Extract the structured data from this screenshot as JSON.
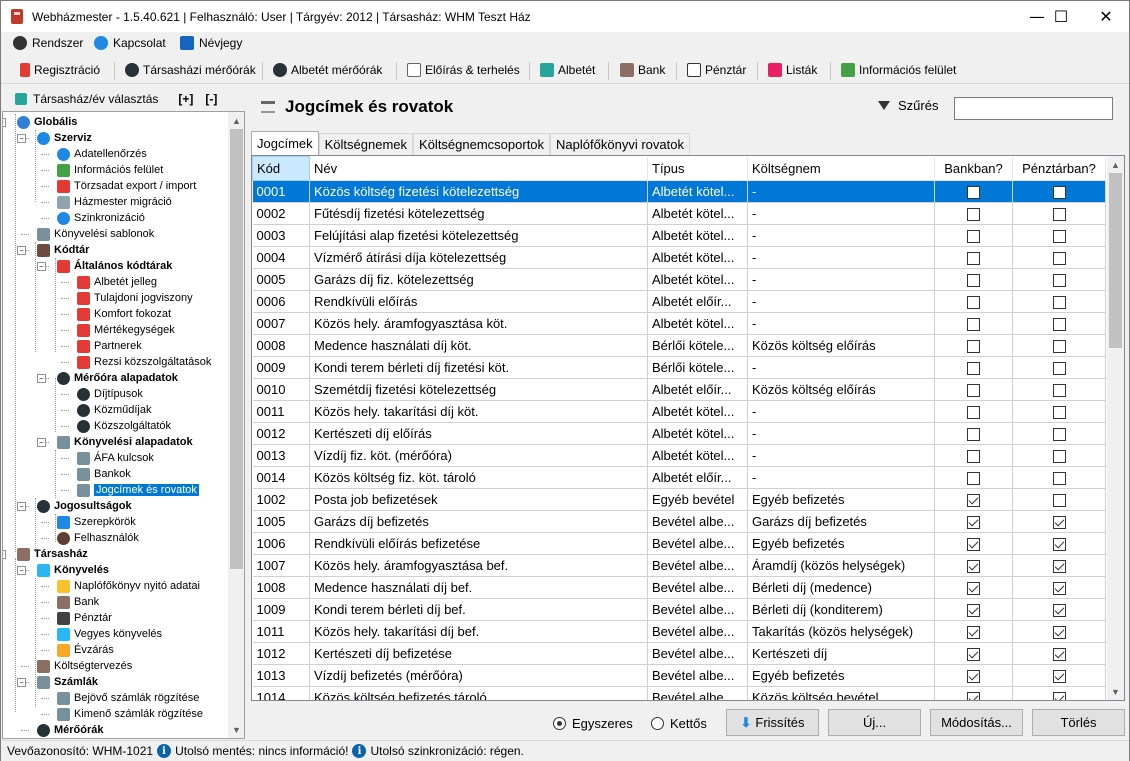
{
  "window": {
    "title": "Webházmester - 1.5.40.621 | Felhasználó: User | Tárgyév: 2012 | Társasház: WHM Teszt Ház",
    "minimize": "—",
    "maximize": "☐",
    "close": "✕"
  },
  "menu": {
    "items": [
      "Rendszer",
      "Kapcsolat",
      "Névjegy"
    ]
  },
  "toolbar": {
    "items": [
      "Regisztráció",
      "Társasházi mérőórák",
      "Albetét mérőórák",
      "Előírás & terhelés",
      "Albetét",
      "Bank",
      "Pénztár",
      "Listák",
      "Információs felület"
    ]
  },
  "sidebar": {
    "select_label": "Társasház/év választás",
    "expand": "[+]",
    "collapse": "[-]"
  },
  "tree": [
    {
      "label": "Globális",
      "level": 0,
      "bold": true,
      "icon": "globe-icon",
      "color": "#2f7fd8"
    },
    {
      "label": "Szerviz",
      "level": 1,
      "bold": true,
      "icon": "info-icon",
      "color": "#1e88e5"
    },
    {
      "label": "Adatellenőrzés",
      "level": 2,
      "icon": "info-icon",
      "color": "#1e88e5"
    },
    {
      "label": "Információs felület",
      "level": 2,
      "icon": "chart-icon",
      "color": "#43a047"
    },
    {
      "label": "Törzsadat export / import",
      "level": 2,
      "icon": "export-icon",
      "color": "#e53935"
    },
    {
      "label": "Házmester migráció",
      "level": 2,
      "icon": "migrate-icon",
      "color": "#90a4ae"
    },
    {
      "label": "Szinkronizáció",
      "level": 2,
      "icon": "sync-icon",
      "color": "#1e88e5"
    },
    {
      "label": "Könyvelési sablonok",
      "level": 1,
      "icon": "template-icon",
      "color": "#78909c"
    },
    {
      "label": "Kódtár",
      "level": 1,
      "bold": true,
      "icon": "book-icon",
      "color": "#6d4c41"
    },
    {
      "label": "Általános kódtárak",
      "level": 2,
      "bold": true,
      "icon": "list-icon",
      "color": "#e53935"
    },
    {
      "label": "Albetét jelleg",
      "level": 3,
      "icon": "list-icon",
      "color": "#e53935"
    },
    {
      "label": "Tulajdoni jogviszony",
      "level": 3,
      "icon": "list-icon",
      "color": "#e53935"
    },
    {
      "label": "Komfort fokozat",
      "level": 3,
      "icon": "list-icon",
      "color": "#e53935"
    },
    {
      "label": "Mértékegységek",
      "level": 3,
      "icon": "list-icon",
      "color": "#e53935"
    },
    {
      "label": "Partnerek",
      "level": 3,
      "icon": "list-icon",
      "color": "#e53935"
    },
    {
      "label": "Rezsi közszolgáltatások",
      "level": 3,
      "icon": "list-icon",
      "color": "#e53935"
    },
    {
      "label": "Mérőóra alapadatok",
      "level": 2,
      "bold": true,
      "icon": "meter-icon",
      "color": "#263238"
    },
    {
      "label": "Díjtípusok",
      "level": 3,
      "icon": "meter-icon",
      "color": "#263238"
    },
    {
      "label": "Közműdíjak",
      "level": 3,
      "icon": "meter-icon",
      "color": "#263238"
    },
    {
      "label": "Közszolgáltatók",
      "level": 3,
      "icon": "meter-icon",
      "color": "#263238"
    },
    {
      "label": "Könyvelési alapadatok",
      "level": 2,
      "bold": true,
      "icon": "list-icon",
      "color": "#78909c"
    },
    {
      "label": "ÁFA kulcsok",
      "level": 3,
      "icon": "list-icon",
      "color": "#78909c"
    },
    {
      "label": "Bankok",
      "level": 3,
      "icon": "list-icon",
      "color": "#78909c"
    },
    {
      "label": "Jogcímek és rovatok",
      "level": 3,
      "icon": "list-icon",
      "color": "#78909c",
      "selected": true
    },
    {
      "label": "Jogosultságok",
      "level": 1,
      "bold": true,
      "icon": "key-icon",
      "color": "#263238"
    },
    {
      "label": "Szerepkörök",
      "level": 2,
      "icon": "role-icon",
      "color": "#1e88e5"
    },
    {
      "label": "Felhasználók",
      "level": 2,
      "icon": "user-icon",
      "color": "#5d4037"
    },
    {
      "label": "Társasház",
      "level": 0,
      "bold": true,
      "icon": "building-icon",
      "color": "#8d6e63"
    },
    {
      "label": "Könyvelés",
      "level": 1,
      "bold": true,
      "icon": "folder-icon",
      "color": "#29b6f6"
    },
    {
      "label": "Naplófőkönyv nyitó adatai",
      "level": 2,
      "icon": "grid-icon",
      "color": "#fbc02d"
    },
    {
      "label": "Bank",
      "level": 2,
      "icon": "bank-icon",
      "color": "#8d6e63"
    },
    {
      "label": "Pénztár",
      "level": 2,
      "icon": "cash-icon",
      "color": "#424242"
    },
    {
      "label": "Vegyes könyvelés",
      "level": 2,
      "icon": "folder-icon",
      "color": "#29b6f6"
    },
    {
      "label": "Évzárás",
      "level": 2,
      "icon": "lock-icon",
      "color": "#f9a825"
    },
    {
      "label": "Költségtervezés",
      "level": 1,
      "icon": "budget-icon",
      "color": "#8d6e63"
    },
    {
      "label": "Számlák",
      "level": 1,
      "bold": true,
      "icon": "invoice-icon",
      "color": "#78909c"
    },
    {
      "label": "Bejövő számlák rögzítése",
      "level": 2,
      "icon": "invoice-in-icon",
      "color": "#78909c"
    },
    {
      "label": "Kimenő számlák rögzítése",
      "level": 2,
      "icon": "invoice-out-icon",
      "color": "#78909c"
    },
    {
      "label": "Mérőórák",
      "level": 1,
      "bold": true,
      "icon": "meter-icon",
      "color": "#263238"
    }
  ],
  "main": {
    "title": "Jogcímek és rovatok",
    "filter_label": "Szűrés",
    "filter_value": "",
    "tabs": [
      "Jogcímek",
      "Költségnemek",
      "Költségnemcsoportok",
      "Naplófőkönyvi rovatok"
    ],
    "columns": [
      "Kód",
      "Név",
      "Típus",
      "Költségnem",
      "Bankban?",
      "Pénztárban?"
    ],
    "rows": [
      {
        "kod": "0001",
        "nev": "Közös költség fizetési kötelezettség",
        "tipus": "Albetét kötel...",
        "koltsegnem": "-",
        "bank": false,
        "penztar": false,
        "selected": true
      },
      {
        "kod": "0002",
        "nev": "Fűtésdíj fizetési kötelezettség",
        "tipus": "Albetét kötel...",
        "koltsegnem": "-",
        "bank": false,
        "penztar": false
      },
      {
        "kod": "0003",
        "nev": "Felújítási alap fizetési kötelezettség",
        "tipus": "Albetét kötel...",
        "koltsegnem": "-",
        "bank": false,
        "penztar": false
      },
      {
        "kod": "0004",
        "nev": "Vízmérő átírási díja kötelezettség",
        "tipus": "Albetét kötel...",
        "koltsegnem": "-",
        "bank": false,
        "penztar": false
      },
      {
        "kod": "0005",
        "nev": "Garázs díj fiz. kötelezettség",
        "tipus": "Albetét kötel...",
        "koltsegnem": "-",
        "bank": false,
        "penztar": false
      },
      {
        "kod": "0006",
        "nev": "Rendkívüli előírás",
        "tipus": "Albetét előír...",
        "koltsegnem": "-",
        "bank": false,
        "penztar": false
      },
      {
        "kod": "0007",
        "nev": "Közös hely. áramfogyasztása köt.",
        "tipus": "Albetét kötel...",
        "koltsegnem": "-",
        "bank": false,
        "penztar": false
      },
      {
        "kod": "0008",
        "nev": "Medence használati díj köt.",
        "tipus": "Bérlői kötele...",
        "koltsegnem": "Közös költség előírás",
        "bank": false,
        "penztar": false
      },
      {
        "kod": "0009",
        "nev": "Kondi terem bérleti díj fizetési köt.",
        "tipus": "Bérlői kötele...",
        "koltsegnem": "-",
        "bank": false,
        "penztar": false
      },
      {
        "kod": "0010",
        "nev": "Szemétdíj fizetési kötelezettség",
        "tipus": "Albetét előír...",
        "koltsegnem": "Közös költség előírás",
        "bank": false,
        "penztar": false
      },
      {
        "kod": "0011",
        "nev": "Közös hely. takarítási díj köt.",
        "tipus": "Albetét kötel...",
        "koltsegnem": "-",
        "bank": false,
        "penztar": false
      },
      {
        "kod": "0012",
        "nev": "Kertészeti díj előírás",
        "tipus": "Albetét kötel...",
        "koltsegnem": "-",
        "bank": false,
        "penztar": false
      },
      {
        "kod": "0013",
        "nev": "Vízdíj fiz. köt. (mérőóra)",
        "tipus": "Albetét kötel...",
        "koltsegnem": "-",
        "bank": false,
        "penztar": false
      },
      {
        "kod": "0014",
        "nev": "Közös költség fiz. köt. tároló",
        "tipus": "Albetét előír...",
        "koltsegnem": "-",
        "bank": false,
        "penztar": false
      },
      {
        "kod": "1002",
        "nev": "Posta job befizetések",
        "tipus": "Egyéb bevétel",
        "koltsegnem": "Egyéb befizetés",
        "bank": true,
        "penztar": false
      },
      {
        "kod": "1005",
        "nev": "Garázs díj befizetés",
        "tipus": "Bevétel albe...",
        "koltsegnem": "Garázs díj befizetés",
        "bank": true,
        "penztar": true
      },
      {
        "kod": "1006",
        "nev": "Rendkívüli előírás befizetése",
        "tipus": "Bevétel albe...",
        "koltsegnem": "Egyéb befizetés",
        "bank": true,
        "penztar": true
      },
      {
        "kod": "1007",
        "nev": "Közös hely. áramfogyasztása bef.",
        "tipus": "Bevétel albe...",
        "koltsegnem": "Áramdíj (közös helységek)",
        "bank": true,
        "penztar": true
      },
      {
        "kod": "1008",
        "nev": "Medence használati díj bef.",
        "tipus": "Bevétel albe...",
        "koltsegnem": "Bérleti díj (medence)",
        "bank": true,
        "penztar": true
      },
      {
        "kod": "1009",
        "nev": "Kondi terem bérleti díj bef.",
        "tipus": "Bevétel albe...",
        "koltsegnem": "Bérleti díj (konditerem)",
        "bank": true,
        "penztar": true
      },
      {
        "kod": "1011",
        "nev": "Közös hely. takarítási díj bef.",
        "tipus": "Bevétel albe...",
        "koltsegnem": "Takarítás (közös helységek)",
        "bank": true,
        "penztar": true
      },
      {
        "kod": "1012",
        "nev": "Kertészeti díj befizetése",
        "tipus": "Bevétel albe...",
        "koltsegnem": "Kertészeti díj",
        "bank": true,
        "penztar": true
      },
      {
        "kod": "1013",
        "nev": "Vízdíj befizetés (mérőóra)",
        "tipus": "Bevétel albe...",
        "koltsegnem": "Egyéb befizetés",
        "bank": true,
        "penztar": true
      },
      {
        "kod": "1014",
        "nev": "Közös költség befizetés tároló",
        "tipus": "Bevétel albe...",
        "koltsegnem": "Közös költség bevétel",
        "bank": true,
        "penztar": true
      }
    ]
  },
  "bottom": {
    "radio_single": "Egyszeres",
    "radio_double": "Kettős",
    "refresh": "Frissítés",
    "new": "Új...",
    "edit": "Módosítás...",
    "delete": "Törlés"
  },
  "status": {
    "device": "Vevőazonosító: WHM-1021",
    "last_save": "Utolsó mentés: nincs információ!",
    "last_sync": "Utolsó szinkronizáció: régen."
  }
}
